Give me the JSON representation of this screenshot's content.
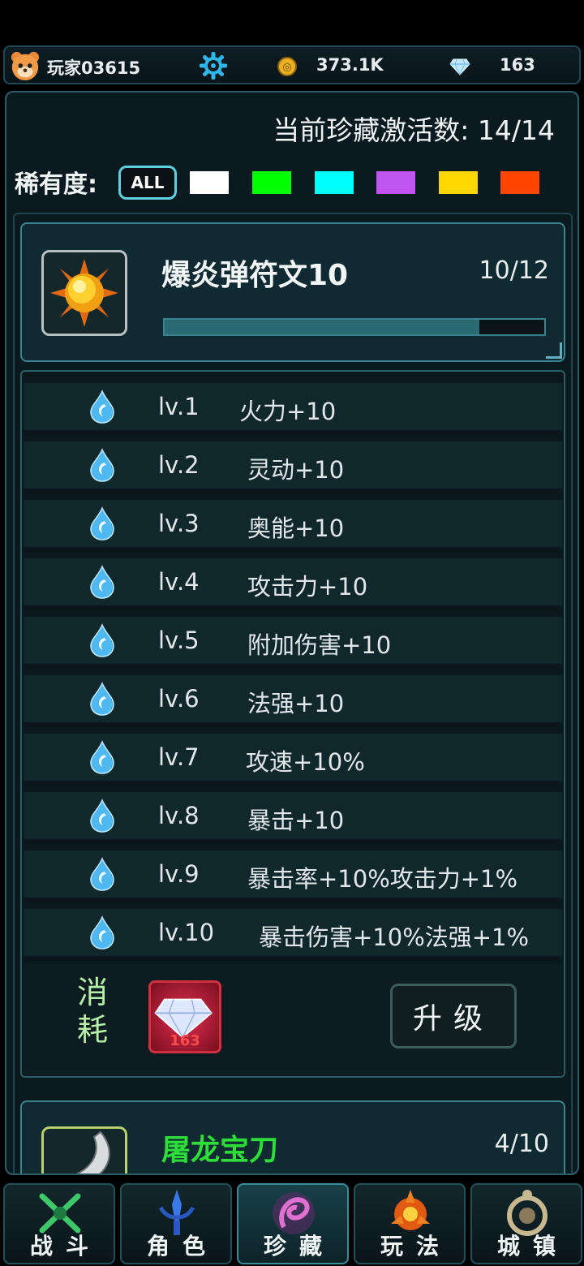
{
  "header": {
    "player_name": "玩家03615",
    "coins": "373.1K",
    "gems": "163",
    "icons": {
      "avatar": "bear-avatar-icon",
      "settings": "gear-icon",
      "coin": "coin-icon",
      "gem": "diamond-icon"
    }
  },
  "collection": {
    "active_count_text": "当前珍藏激活数: 14/14",
    "rarity_label": "稀有度:",
    "filter_all_label": "ALL",
    "rarity_colors": [
      "#ffffff",
      "#00ff00",
      "#00ffff",
      "#bf55ec",
      "#ffd700",
      "#ff4500"
    ]
  },
  "item": {
    "name": "爆炎弹符文10",
    "progress_text": "10/12",
    "progress_value": 0.83,
    "icon": "fire-orb-icon"
  },
  "levels": [
    {
      "lv": "lv.1",
      "bonus": "火力+10"
    },
    {
      "lv": "lv.2",
      "bonus": "灵动+10"
    },
    {
      "lv": "lv.3",
      "bonus": "奥能+10"
    },
    {
      "lv": "lv.4",
      "bonus": "攻击力+10"
    },
    {
      "lv": "lv.5",
      "bonus": "附加伤害+10"
    },
    {
      "lv": "lv.6",
      "bonus": "法强+10"
    },
    {
      "lv": "lv.7",
      "bonus": "攻速+10%"
    },
    {
      "lv": "lv.8",
      "bonus": "暴击+10"
    },
    {
      "lv": "lv.9",
      "bonus": "暴击率+10%攻击力+1%"
    },
    {
      "lv": "lv.10",
      "bonus": "暴击伤害+10%法强+1%"
    }
  ],
  "cost": {
    "label_line1": "消",
    "label_line2": "耗",
    "count": "163",
    "upgrade_label": "升级"
  },
  "next_item": {
    "name": "屠龙宝刀",
    "progress_text": "4/10",
    "icon": "blade-icon"
  },
  "nav": [
    {
      "label": "战斗",
      "icon": "crossed-swords-icon",
      "active": false
    },
    {
      "label": "角色",
      "icon": "sword-emblem-icon",
      "active": false
    },
    {
      "label": "珍藏",
      "icon": "treasure-swirl-icon",
      "active": true
    },
    {
      "label": "玩法",
      "icon": "flame-emblem-icon",
      "active": false
    },
    {
      "label": "城镇",
      "icon": "town-emblem-icon",
      "active": false
    }
  ]
}
